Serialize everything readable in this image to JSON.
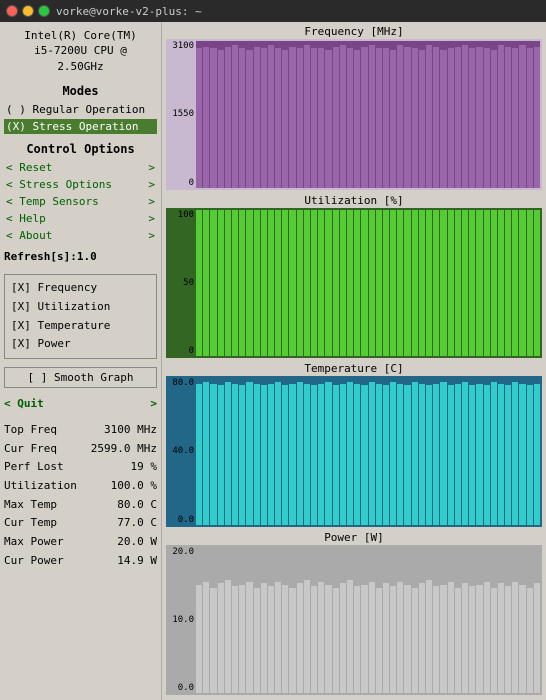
{
  "titlebar": {
    "title": "vorke@vorke-v2-plus: ~"
  },
  "cpu": {
    "name": "Intel(R) Core(TM)",
    "model": "i5-7200U CPU @",
    "speed": "2.50GHz"
  },
  "modes": {
    "title": "Modes",
    "regular": "( ) Regular Operation",
    "stress": "(X) Stress Operation"
  },
  "controls": {
    "title": "Control Options",
    "items": [
      {
        "label": "< Reset",
        "arrow": ">"
      },
      {
        "label": "< Stress Options",
        "arrow": ">"
      },
      {
        "label": "< Temp Sensors",
        "arrow": ">"
      },
      {
        "label": "< Help",
        "arrow": ">"
      },
      {
        "label": "< About",
        "arrow": ">"
      }
    ]
  },
  "refresh": "Refresh[s]:1.0",
  "checkboxes": [
    "[X] Frequency",
    "[X] Utilization",
    "[X] Temperature",
    "[X] Power"
  ],
  "smooth_graph": "[ ] Smooth Graph",
  "quit": {
    "label": "< Quit",
    "arrow": ">"
  },
  "stats": [
    {
      "label": "Top Freq",
      "value": "3100 MHz"
    },
    {
      "label": "Cur Freq",
      "value": "2599.0 MHz"
    },
    {
      "label": "Perf Lost",
      "value": "19 %"
    },
    {
      "label": "Utilization",
      "value": "100.0 %"
    },
    {
      "label": "Max Temp",
      "value": "80.0 C"
    },
    {
      "label": "Cur Temp",
      "value": "77.0 C"
    },
    {
      "label": "Max Power",
      "value": "20.0 W"
    },
    {
      "label": "Cur Power",
      "value": "14.9 W"
    }
  ],
  "charts": {
    "frequency": {
      "title": "Frequency [MHz]",
      "y_labels": [
        "3100",
        "1550",
        "0"
      ],
      "bars": [
        95,
        96,
        95,
        94,
        96,
        97,
        95,
        94,
        96,
        95,
        97,
        95,
        94,
        96,
        95,
        97,
        95,
        95,
        94,
        96,
        97,
        95,
        94,
        96,
        97,
        95,
        95,
        94,
        97,
        96,
        95,
        94,
        97,
        96,
        94,
        95,
        96,
        97,
        95,
        96,
        95,
        94,
        97,
        96,
        95,
        97,
        95,
        96
      ]
    },
    "utilization": {
      "title": "Utilization [%]",
      "y_labels": [
        "100",
        "50",
        "0"
      ],
      "bars": [
        100,
        100,
        100,
        100,
        100,
        100,
        100,
        100,
        100,
        100,
        100,
        100,
        100,
        100,
        100,
        100,
        100,
        100,
        100,
        100,
        100,
        100,
        100,
        100,
        100,
        100,
        100,
        100,
        100,
        100,
        100,
        100,
        100,
        100,
        100,
        100,
        100,
        100,
        100,
        100,
        100,
        100,
        100,
        100,
        100,
        100,
        100,
        100
      ]
    },
    "temperature": {
      "title": "Temperature [C]",
      "y_labels": [
        "80.0",
        "40.0",
        "0.0"
      ],
      "bars": [
        96,
        97,
        96,
        95,
        97,
        96,
        95,
        97,
        96,
        95,
        96,
        97,
        95,
        96,
        97,
        96,
        95,
        96,
        97,
        95,
        96,
        97,
        96,
        95,
        97,
        96,
        95,
        97,
        96,
        95,
        97,
        96,
        95,
        96,
        97,
        95,
        96,
        97,
        95,
        96,
        95,
        97,
        96,
        95,
        97,
        96,
        95,
        96
      ]
    },
    "power": {
      "title": "Power [W]",
      "y_labels": [
        "20.0",
        "10.0",
        "0.0"
      ],
      "bars": [
        74,
        76,
        72,
        75,
        77,
        73,
        74,
        76,
        72,
        75,
        73,
        76,
        74,
        72,
        75,
        77,
        73,
        76,
        74,
        72,
        75,
        77,
        73,
        74,
        76,
        72,
        75,
        73,
        76,
        74,
        72,
        75,
        77,
        73,
        74,
        76,
        72,
        75,
        73,
        74,
        76,
        72,
        75,
        73,
        76,
        74,
        72,
        75
      ]
    }
  }
}
